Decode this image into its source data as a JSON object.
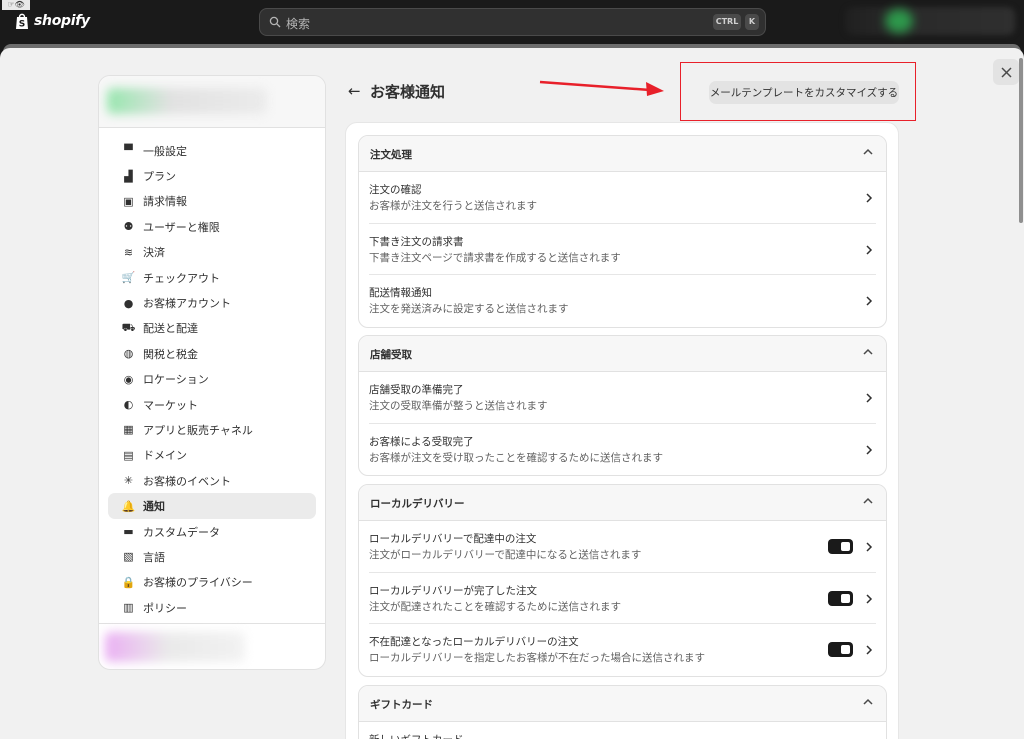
{
  "topbar": {
    "brand": "shopify",
    "search_placeholder": "検索",
    "shortcut_ctrl": "CTRL",
    "shortcut_k": "K"
  },
  "header": {
    "title": "お客様通知",
    "customize_button": "メールテンプレートをカスタマイズする"
  },
  "sidebar": {
    "items": [
      {
        "label": "一般設定",
        "icon": "store-icon"
      },
      {
        "label": "プラン",
        "icon": "plan-chart-icon"
      },
      {
        "label": "請求情報",
        "icon": "billing-icon"
      },
      {
        "label": "ユーザーと権限",
        "icon": "users-icon"
      },
      {
        "label": "決済",
        "icon": "payment-icon"
      },
      {
        "label": "チェックアウト",
        "icon": "cart-icon"
      },
      {
        "label": "お客様アカウント",
        "icon": "person-icon"
      },
      {
        "label": "配送と配達",
        "icon": "truck-icon"
      },
      {
        "label": "関税と税金",
        "icon": "money-bag-icon"
      },
      {
        "label": "ロケーション",
        "icon": "location-pin-icon"
      },
      {
        "label": "マーケット",
        "icon": "globe-icon"
      },
      {
        "label": "アプリと販売チャネル",
        "icon": "apps-icon"
      },
      {
        "label": "ドメイン",
        "icon": "domain-icon"
      },
      {
        "label": "お客様のイベント",
        "icon": "events-icon"
      },
      {
        "label": "通知",
        "icon": "bell-icon",
        "active": true
      },
      {
        "label": "カスタムデータ",
        "icon": "custom-data-icon"
      },
      {
        "label": "言語",
        "icon": "language-icon"
      },
      {
        "label": "お客様のプライバシー",
        "icon": "lock-icon"
      },
      {
        "label": "ポリシー",
        "icon": "policy-icon"
      }
    ]
  },
  "sections": [
    {
      "title": "注文処理",
      "rows": [
        {
          "title": "注文の確認",
          "desc": "お客様が注文を行うと送信されます",
          "toggle": false
        },
        {
          "title": "下書き注文の請求書",
          "desc": "下書き注文ページで請求書を作成すると送信されます",
          "toggle": false
        },
        {
          "title": "配送情報通知",
          "desc": "注文を発送済みに設定すると送信されます",
          "toggle": false
        }
      ]
    },
    {
      "title": "店舗受取",
      "rows": [
        {
          "title": "店舗受取の準備完了",
          "desc": "注文の受取準備が整うと送信されます",
          "toggle": false
        },
        {
          "title": "お客様による受取完了",
          "desc": "お客様が注文を受け取ったことを確認するために送信されます",
          "toggle": false
        }
      ]
    },
    {
      "title": "ローカルデリバリー",
      "rows": [
        {
          "title": "ローカルデリバリーで配達中の注文",
          "desc": "注文がローカルデリバリーで配達中になると送信されます",
          "toggle": true
        },
        {
          "title": "ローカルデリバリーが完了した注文",
          "desc": "注文が配達されたことを確認するために送信されます",
          "toggle": true
        },
        {
          "title": "不在配達となったローカルデリバリーの注文",
          "desc": "ローカルデリバリーを指定したお客様が不在だった場合に送信されます",
          "toggle": true
        }
      ]
    },
    {
      "title": "ギフトカード",
      "rows": [
        {
          "title": "新しいギフトカード",
          "desc": "",
          "toggle": false
        }
      ]
    }
  ],
  "colors": {
    "topbar": "#1a1a1a",
    "modal_bg": "#f1f1f1",
    "annotation_red": "#e8202a",
    "toggle_on": "#1a1a1a"
  }
}
